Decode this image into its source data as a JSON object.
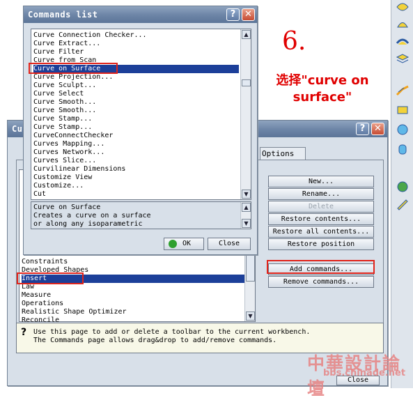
{
  "annotation": {
    "step_number": "6.",
    "instruction_line1": "选择\"curve on",
    "instruction_line2": "surface\""
  },
  "customize_window": {
    "title_prefix": "Cu",
    "help_label": "?",
    "close_label": "✕",
    "tab_label": "Options",
    "toolbars_list_items": [
      "Constraints",
      "Developed Shapes",
      "Insert",
      "Law",
      "Measure",
      "Operations",
      "Realistic Shape Optimizer",
      "Reconcile"
    ],
    "selected_toolbar": "Insert",
    "buttons": {
      "new": "New...",
      "rename": "Rename...",
      "delete": "Delete",
      "restore_contents": "Restore contents...",
      "restore_all_contents": "Restore all contents...",
      "restore_position": "Restore position",
      "add_commands": "Add commands...",
      "remove_commands": "Remove commands..."
    },
    "info_icon": "?",
    "info_line1": "Use this page to add or delete a toolbar to the current workbench.",
    "info_line2": "The Commands page allows drag&drop to add/remove commands.",
    "bottom_close_label": "Close"
  },
  "commands_list_window": {
    "title": "Commands list",
    "help_label": "?",
    "close_label": "✕",
    "items": [
      "Curve Connection Checker...",
      "Curve Extract...",
      "Curve Filter",
      "Curve from Scan",
      "Curve on Surface",
      "Curve Projection...",
      "Curve Sculpt...",
      "Curve Select",
      "Curve Smooth...",
      "Curve Smooth...",
      "Curve Stamp...",
      "Curve Stamp...",
      "CurveConnectChecker",
      "Curves Mapping...",
      "Curves Network...",
      "Curves Slice...",
      "Curvilinear Dimensions",
      "Customize View",
      "Customize...",
      "Cut"
    ],
    "selected_item": "Curve on Surface",
    "description_lines": [
      "Curve on Surface",
      "Creates a curve on a surface",
      "or along any isoparametric"
    ],
    "ok_label": "OK",
    "close_button_label": "Close"
  },
  "watermark": {
    "chinese": "中華設計論壇",
    "url": "bbs.chinade.net"
  },
  "colors": {
    "selection": "#1c3f99",
    "annotation_red": "#e00000",
    "highlight_box": "#e2231a",
    "titlebar": "#6c84a6"
  }
}
